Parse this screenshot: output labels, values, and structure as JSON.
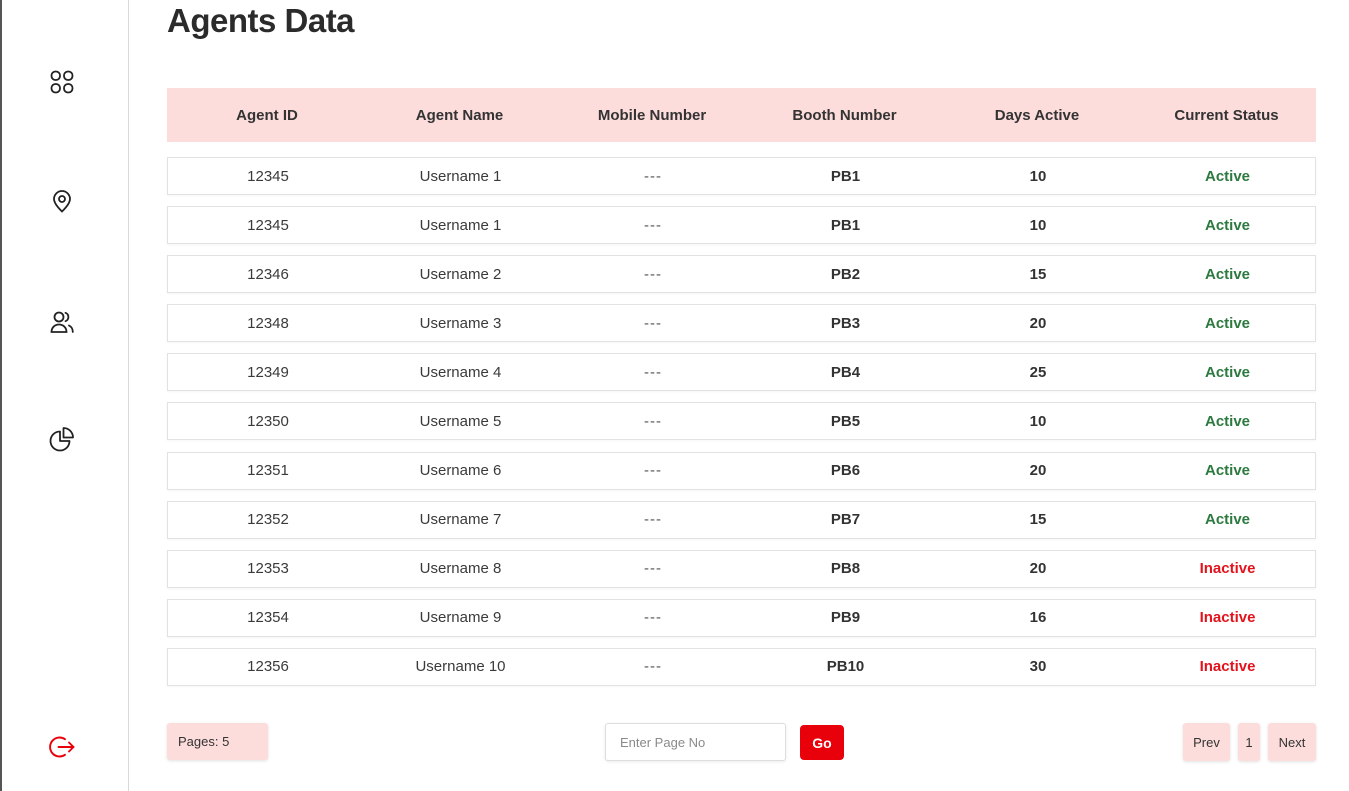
{
  "page": {
    "title": "Agents Data"
  },
  "sidebar": {
    "items": [
      {
        "icon": "dashboard-grid-icon"
      },
      {
        "icon": "location-pin-icon"
      },
      {
        "icon": "users-icon"
      },
      {
        "icon": "pie-chart-icon"
      },
      {
        "icon": "logout-icon"
      }
    ]
  },
  "table": {
    "headers": [
      "Agent ID",
      "Agent Name",
      "Mobile Number",
      "Booth Number",
      "Days Active",
      "Current Status"
    ],
    "rows": [
      {
        "id": "12345",
        "name": "Username 1",
        "mobile": "---",
        "booth": "PB1",
        "days": "10",
        "status": "Active"
      },
      {
        "id": "12345",
        "name": "Username 1",
        "mobile": "---",
        "booth": "PB1",
        "days": "10",
        "status": "Active"
      },
      {
        "id": "12346",
        "name": "Username 2",
        "mobile": "---",
        "booth": "PB2",
        "days": "15",
        "status": "Active"
      },
      {
        "id": "12348",
        "name": "Username 3",
        "mobile": "---",
        "booth": "PB3",
        "days": "20",
        "status": "Active"
      },
      {
        "id": "12349",
        "name": "Username 4",
        "mobile": "---",
        "booth": "PB4",
        "days": "25",
        "status": "Active"
      },
      {
        "id": "12350",
        "name": "Username 5",
        "mobile": "---",
        "booth": "PB5",
        "days": "10",
        "status": "Active"
      },
      {
        "id": "12351",
        "name": "Username 6",
        "mobile": "---",
        "booth": "PB6",
        "days": "20",
        "status": "Active"
      },
      {
        "id": "12352",
        "name": "Username 7",
        "mobile": "---",
        "booth": "PB7",
        "days": "15",
        "status": "Active"
      },
      {
        "id": "12353",
        "name": "Username 8",
        "mobile": "---",
        "booth": "PB8",
        "days": "20",
        "status": "Inactive"
      },
      {
        "id": "12354",
        "name": "Username 9",
        "mobile": "---",
        "booth": "PB9",
        "days": "16",
        "status": "Inactive"
      },
      {
        "id": "12356",
        "name": "Username 10",
        "mobile": "---",
        "booth": "PB10",
        "days": "30",
        "status": "Inactive"
      }
    ]
  },
  "pagination": {
    "pages_label": "Pages: 5",
    "input_placeholder": "Enter Page No",
    "go_label": "Go",
    "prev_label": "Prev",
    "current_page": "1",
    "next_label": "Next"
  },
  "colors": {
    "accent_red": "#e8000b",
    "header_bg": "#fddcdc",
    "active_green": "#2c7a3f",
    "inactive_red": "#e3121b"
  }
}
